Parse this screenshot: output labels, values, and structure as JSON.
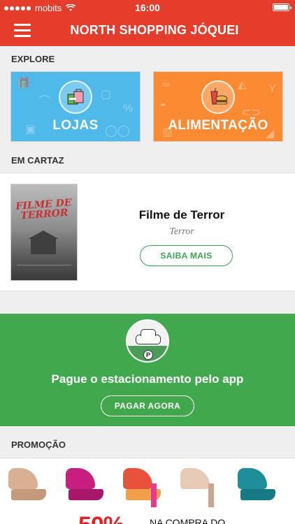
{
  "status_bar": {
    "carrier": "mobits",
    "time": "16:00"
  },
  "header": {
    "title": "NORTH SHOPPING JÓQUEI",
    "menu_icon": "hamburger-menu-icon"
  },
  "explore": {
    "label": "EXPLORE",
    "tiles": [
      {
        "label": "LOJAS",
        "icon": "shopping-bags-icon",
        "color": "#4fb9ea"
      },
      {
        "label": "ALIMENTAÇÃO",
        "icon": "food-drink-icon",
        "color": "#fc8a33"
      }
    ]
  },
  "em_cartaz": {
    "label": "EM CARTAZ",
    "movie": {
      "poster_title": "FILME DE TERROR",
      "title": "Filme de Terror",
      "genre": "Terror",
      "button": "SAIBA MAIS"
    }
  },
  "parking": {
    "icon": "car-parking-icon",
    "text": "Pague o estacionamento pelo app",
    "button": "PAGAR AGORA",
    "color": "#41a84e"
  },
  "promocao": {
    "label": "PROMOÇÃO",
    "banner_text_big": "50%",
    "banner_text_small": "NA COMPRA DO"
  },
  "colors": {
    "primary": "#e43d2c",
    "accent_green": "#3ba554"
  }
}
